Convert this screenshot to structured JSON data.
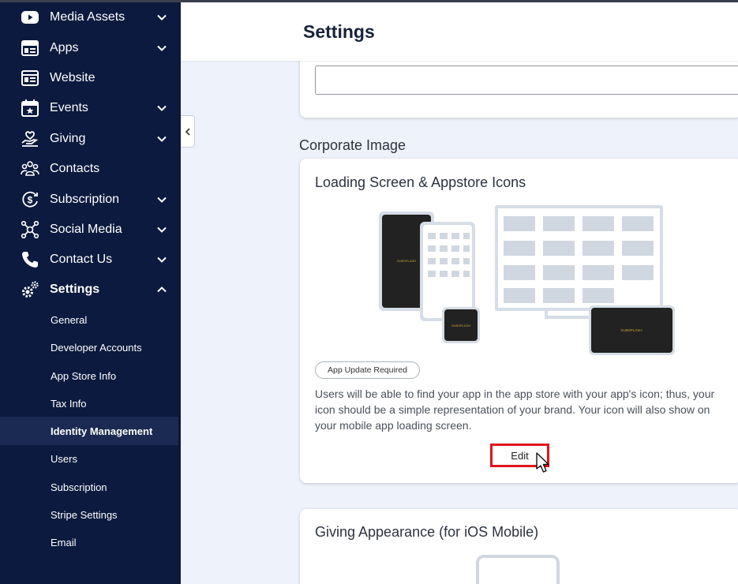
{
  "sidebar": {
    "items": [
      {
        "label": "Media Assets",
        "icon": "youtube-icon",
        "expandable": true
      },
      {
        "label": "Apps",
        "icon": "apps-icon",
        "expandable": true
      },
      {
        "label": "Website",
        "icon": "website-icon",
        "expandable": false
      },
      {
        "label": "Events",
        "icon": "calendar-star-icon",
        "expandable": true
      },
      {
        "label": "Giving",
        "icon": "giving-hand-icon",
        "expandable": true
      },
      {
        "label": "Contacts",
        "icon": "contacts-icon",
        "expandable": false
      },
      {
        "label": "Subscription",
        "icon": "subscription-dollar-icon",
        "expandable": true
      },
      {
        "label": "Social Media",
        "icon": "social-network-icon",
        "expandable": true
      },
      {
        "label": "Contact Us",
        "icon": "phone-icon",
        "expandable": true
      },
      {
        "label": "Settings",
        "icon": "gears-icon",
        "expandable": true,
        "expanded": true
      }
    ],
    "settings_sub_items": [
      {
        "label": "General"
      },
      {
        "label": "Developer Accounts"
      },
      {
        "label": "App Store Info"
      },
      {
        "label": "Tax Info"
      },
      {
        "label": "Identity Management",
        "selected": true
      },
      {
        "label": "Users"
      },
      {
        "label": "Subscription"
      },
      {
        "label": "Stripe Settings"
      },
      {
        "label": "Email"
      }
    ]
  },
  "header": {
    "title": "Settings"
  },
  "sections": {
    "corporate_image_title": "Corporate Image",
    "loading_card": {
      "title": "Loading Screen & Appstore Icons",
      "badge": "App Update Required",
      "description": "Users will be able to find your app in the app store with your app's icon; thus, your icon should be a simple representation of your brand. Your icon will also show on your mobile app loading screen.",
      "edit_label": "Edit"
    },
    "giving_card": {
      "title": "Giving Appearance (for iOS Mobile)"
    }
  },
  "colors": {
    "sidebar_bg": "#0b1a3e",
    "selected_bg": "#1b2a52",
    "page_bg": "#eef2fa",
    "highlight": "#e0141c"
  }
}
